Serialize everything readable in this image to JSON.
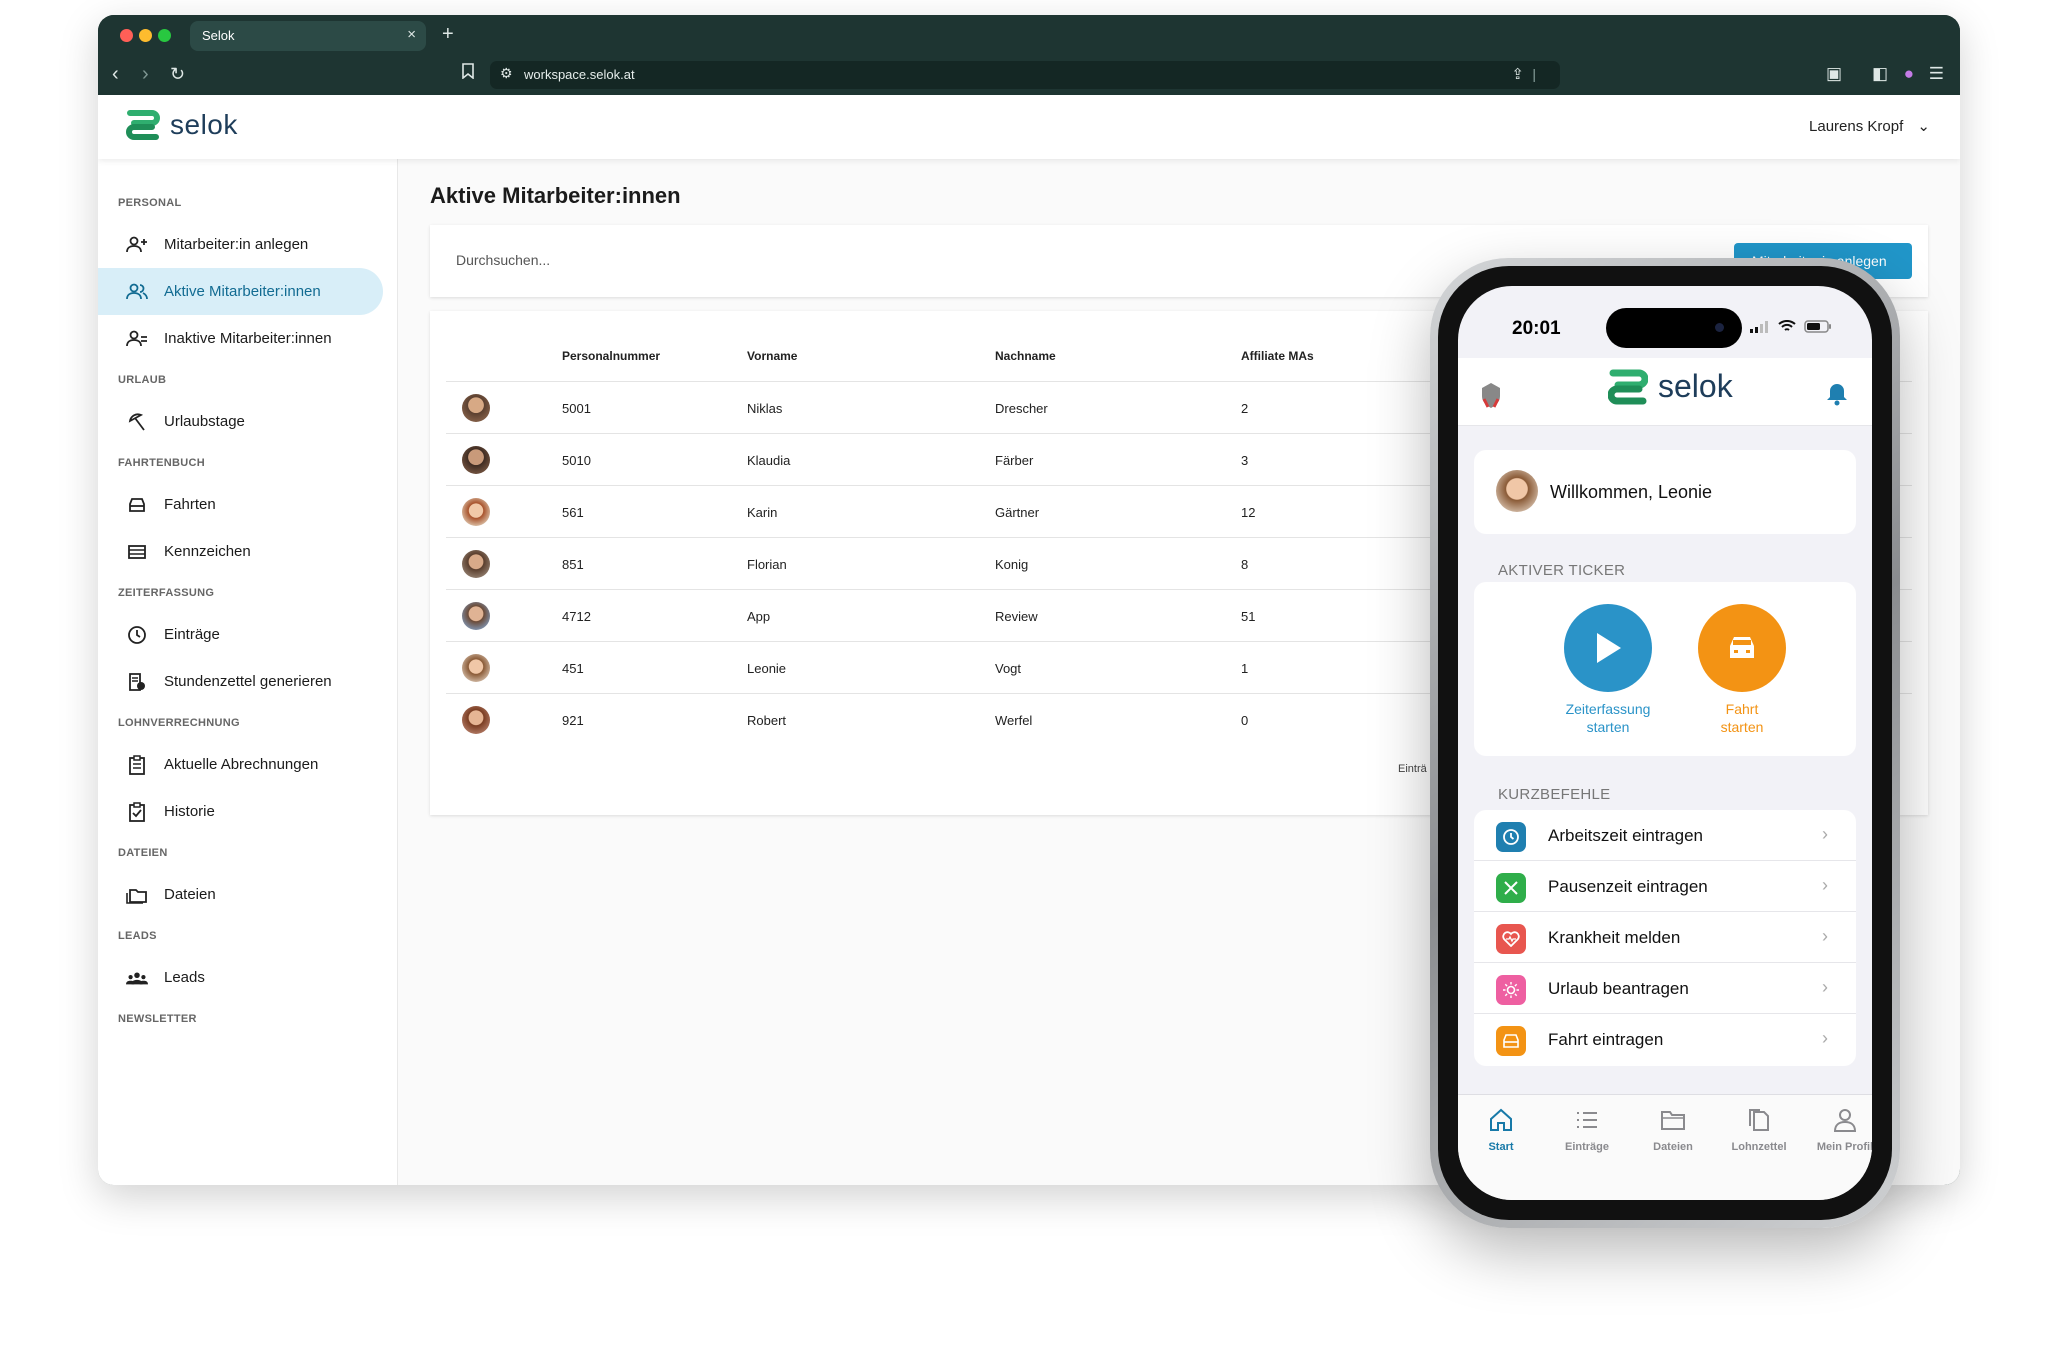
{
  "browser": {
    "tab_title": "Selok",
    "tab_close": "×",
    "new_tab": "+",
    "url": "workspace.selok.at"
  },
  "app": {
    "brand": "selok",
    "user_name": "Laurens Kropf",
    "user_menu_chevron": "⌄"
  },
  "sidebar": {
    "sections": [
      {
        "title": "PERSONAL",
        "items": [
          "Mitarbeiter:in anlegen",
          "Aktive Mitarbeiter:innen",
          "Inaktive Mitarbeiter:innen"
        ]
      },
      {
        "title": "URLAUB",
        "items": [
          "Urlaubstage"
        ]
      },
      {
        "title": "FAHRTENBUCH",
        "items": [
          "Fahrten",
          "Kennzeichen"
        ]
      },
      {
        "title": "ZEITERFASSUNG",
        "items": [
          "Einträge",
          "Stundenzettel generieren"
        ]
      },
      {
        "title": "LOHNVERRECHNUNG",
        "items": [
          "Aktuelle Abrechnungen",
          "Historie"
        ]
      },
      {
        "title": "DATEIEN",
        "items": [
          "Dateien"
        ]
      },
      {
        "title": "LEADS",
        "items": [
          "Leads"
        ]
      },
      {
        "title": "NEWSLETTER",
        "items": []
      }
    ]
  },
  "main": {
    "title": "Aktive Mitarbeiter:innen",
    "search_placeholder": "Durchsuchen...",
    "add_button": "Mitarbeiter:in anlegen",
    "columns": [
      "Personalnummer",
      "Vorname",
      "Nachname",
      "Affiliate MAs"
    ],
    "rows": [
      {
        "nr": "5001",
        "vorname": "Niklas",
        "nachname": "Drescher",
        "affiliate": "2"
      },
      {
        "nr": "5010",
        "vorname": "Klaudia",
        "nachname": "Färber",
        "affiliate": "3"
      },
      {
        "nr": "561",
        "vorname": "Karin",
        "nachname": "Gärtner",
        "affiliate": "12"
      },
      {
        "nr": "851",
        "vorname": "Florian",
        "nachname": "Konig",
        "affiliate": "8"
      },
      {
        "nr": "4712",
        "vorname": "App",
        "nachname": "Review",
        "affiliate": "51"
      },
      {
        "nr": "451",
        "vorname": "Leonie",
        "nachname": "Vogt",
        "affiliate": "1"
      },
      {
        "nr": "921",
        "vorname": "Robert",
        "nachname": "Werfel",
        "affiliate": "0"
      }
    ],
    "footer_partial": "Einträ"
  },
  "phone": {
    "time": "20:01",
    "brand": "selok",
    "welcome": "Willkommen, Leonie",
    "ticker_label": "AKTIVER TICKER",
    "ticker": [
      {
        "label_line1": "Zeiterfassung",
        "label_line2": "starten",
        "color": "#2a93c8"
      },
      {
        "label_line1": "Fahrt",
        "label_line2": "starten",
        "color": "#f39314"
      }
    ],
    "shortcuts_label": "KURZBEFEHLE",
    "shortcuts": [
      {
        "label": "Arbeitszeit eintragen",
        "icon": "clock-icon",
        "color": "#1f7fb0"
      },
      {
        "label": "Pausenzeit eintragen",
        "icon": "cutlery-icon",
        "color": "#2fae4a"
      },
      {
        "label": "Krankheit melden",
        "icon": "heart-pulse-icon",
        "color": "#e8564f"
      },
      {
        "label": "Urlaub beantragen",
        "icon": "sun-icon",
        "color": "#ee5fa1"
      },
      {
        "label": "Fahrt eintragen",
        "icon": "car-icon",
        "color": "#f39314"
      }
    ],
    "chevron": "›",
    "tabs": [
      "Start",
      "Einträge",
      "Dateien",
      "Lohnzettel",
      "Mein Profil"
    ]
  }
}
